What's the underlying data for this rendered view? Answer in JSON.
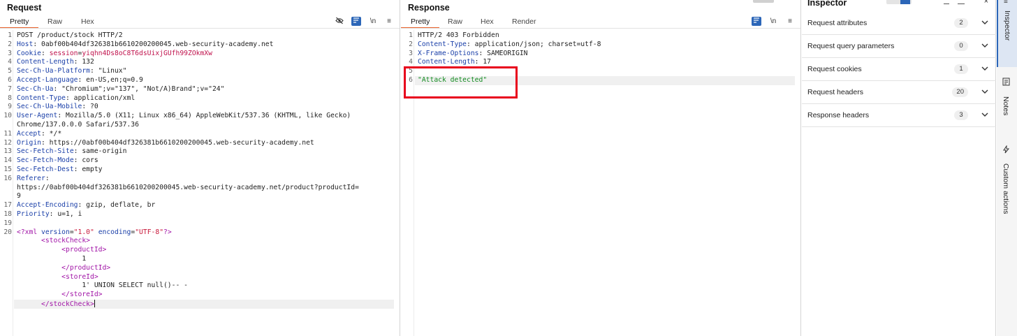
{
  "request": {
    "title": "Request",
    "tabs": [
      "Pretty",
      "Raw",
      "Hex"
    ],
    "active_tab": "Pretty",
    "toolbar": {
      "hide_icon": "eye-slash-icon",
      "wrap_icon": "wrap-lines-icon",
      "newline": "\\n",
      "menu": "≡"
    },
    "line_numbers": [
      "1",
      "2",
      "3",
      "4",
      "5",
      "6",
      "7",
      "8",
      "9",
      "10",
      "",
      "11",
      "12",
      "13",
      "14",
      "15",
      "16",
      "",
      "",
      "17",
      "18",
      "19",
      "20",
      "",
      "",
      "",
      "",
      "",
      "",
      "",
      ""
    ],
    "lines": [
      {
        "n": "1",
        "parts": [
          [
            "POST /product/stock HTTP/2",
            ""
          ]
        ]
      },
      {
        "n": "2",
        "parts": [
          [
            "Host",
            ":k"
          ],
          [
            ": 0abf00b404df326381b6610200200045.web-security-academy.net",
            ""
          ]
        ]
      },
      {
        "n": "3",
        "parts": [
          [
            "Cookie",
            ":k"
          ],
          [
            ": ",
            ""
          ],
          [
            "session",
            "v-red"
          ],
          [
            "=",
            ""
          ],
          [
            "yiqhn4Ds8oC8T6dsUixjGUfh99ZOkmXw",
            "v-red"
          ]
        ]
      },
      {
        "n": "4",
        "parts": [
          [
            "Content-Length",
            ":k"
          ],
          [
            ": 132",
            ""
          ]
        ]
      },
      {
        "n": "5",
        "parts": [
          [
            "Sec-Ch-Ua-Platform",
            ":k"
          ],
          [
            ": \"Linux\"",
            ""
          ]
        ]
      },
      {
        "n": "6",
        "parts": [
          [
            "Accept-Language",
            ":k"
          ],
          [
            ": en-US,en;q=0.9",
            ""
          ]
        ]
      },
      {
        "n": "7",
        "parts": [
          [
            "Sec-Ch-Ua",
            ":k"
          ],
          [
            ": \"Chromium\";v=\"137\", \"Not/A)Brand\";v=\"24\"",
            ""
          ]
        ]
      },
      {
        "n": "8",
        "parts": [
          [
            "Content-Type",
            ":k"
          ],
          [
            ": application/xml",
            ""
          ]
        ]
      },
      {
        "n": "9",
        "parts": [
          [
            "Sec-Ch-Ua-Mobile",
            ":k"
          ],
          [
            ": ?0",
            ""
          ]
        ]
      },
      {
        "n": "10",
        "parts": [
          [
            "User-Agent",
            ":k"
          ],
          [
            ": Mozilla/5.0 (X11; Linux x86_64) AppleWebKit/537.36 (KHTML, like Gecko)",
            ""
          ]
        ]
      },
      {
        "n": "",
        "parts": [
          [
            "Chrome/137.0.0.0 Safari/537.36",
            ""
          ]
        ]
      },
      {
        "n": "11",
        "parts": [
          [
            "Accept",
            ":k"
          ],
          [
            ": */*",
            ""
          ]
        ]
      },
      {
        "n": "12",
        "parts": [
          [
            "Origin",
            ":k"
          ],
          [
            ": https://0abf00b404df326381b6610200200045.web-security-academy.net",
            ""
          ]
        ]
      },
      {
        "n": "13",
        "parts": [
          [
            "Sec-Fetch-Site",
            ":k"
          ],
          [
            ": same-origin",
            ""
          ]
        ]
      },
      {
        "n": "14",
        "parts": [
          [
            "Sec-Fetch-Mode",
            ":k"
          ],
          [
            ": cors",
            ""
          ]
        ]
      },
      {
        "n": "15",
        "parts": [
          [
            "Sec-Fetch-Dest",
            ":k"
          ],
          [
            ": empty",
            ""
          ]
        ]
      },
      {
        "n": "16",
        "parts": [
          [
            "Referer",
            ":k"
          ],
          [
            ":",
            ""
          ]
        ]
      },
      {
        "n": "",
        "parts": [
          [
            "https://0abf00b404df326381b6610200200045.web-security-academy.net/product?productId=",
            ""
          ]
        ]
      },
      {
        "n": "",
        "parts": [
          [
            "9",
            ""
          ]
        ]
      },
      {
        "n": "17",
        "parts": [
          [
            "Accept-Encoding",
            ":k"
          ],
          [
            ": gzip, deflate, br",
            ""
          ]
        ]
      },
      {
        "n": "18",
        "parts": [
          [
            "Priority",
            ":k"
          ],
          [
            ": u=1, i",
            ""
          ]
        ]
      },
      {
        "n": "19",
        "parts": [
          [
            "",
            ""
          ]
        ]
      },
      {
        "n": "20",
        "parts": [
          [
            "<?xml ",
            "t-purple"
          ],
          [
            "version",
            "k"
          ],
          [
            "=",
            ""
          ],
          [
            "\"1.0\"",
            "s-red"
          ],
          [
            " ",
            ""
          ],
          [
            "encoding",
            "k"
          ],
          [
            "=",
            ""
          ],
          [
            "\"UTF-8\"",
            "s-red"
          ],
          [
            "?>",
            "t-purple"
          ]
        ]
      },
      {
        "n": "",
        "parts": [
          [
            "      ",
            ""
          ],
          [
            "<stockCheck>",
            "t-purple"
          ]
        ]
      },
      {
        "n": "",
        "parts": [
          [
            "           ",
            ""
          ],
          [
            "<productId>",
            "t-purple"
          ]
        ]
      },
      {
        "n": "",
        "parts": [
          [
            "                1",
            ""
          ]
        ]
      },
      {
        "n": "",
        "parts": [
          [
            "           ",
            ""
          ],
          [
            "</productId>",
            "t-purple"
          ]
        ]
      },
      {
        "n": "",
        "parts": [
          [
            "           ",
            ""
          ],
          [
            "<storeId>",
            "t-purple"
          ]
        ]
      },
      {
        "n": "",
        "parts": [
          [
            "                1' UNION SELECT null()-- -",
            ""
          ]
        ]
      },
      {
        "n": "",
        "parts": [
          [
            "           ",
            ""
          ],
          [
            "</storeId>",
            "t-purple"
          ]
        ]
      },
      {
        "n": "",
        "parts": [
          [
            "      ",
            ""
          ],
          [
            "</stockCheck>",
            "t-purple"
          ]
        ]
      }
    ]
  },
  "response": {
    "title": "Response",
    "tabs": [
      "Pretty",
      "Raw",
      "Hex",
      "Render"
    ],
    "active_tab": "Pretty",
    "toolbar": {
      "wrap_icon": "wrap-lines-icon",
      "newline": "\\n",
      "menu": "≡"
    },
    "lines": [
      {
        "n": "1",
        "parts": [
          [
            "HTTP/2 403 Forbidden",
            ""
          ]
        ]
      },
      {
        "n": "2",
        "parts": [
          [
            "Content-Type",
            ":k"
          ],
          [
            ": application/json; charset=utf-8",
            ""
          ]
        ]
      },
      {
        "n": "3",
        "parts": [
          [
            "X-Frame-Options",
            ":k"
          ],
          [
            ": SAMEORIGIN",
            ""
          ]
        ]
      },
      {
        "n": "4",
        "parts": [
          [
            "Content-Length",
            ":k"
          ],
          [
            ": 17",
            ""
          ]
        ]
      },
      {
        "n": "5",
        "parts": [
          [
            "",
            ""
          ]
        ]
      },
      {
        "n": "6",
        "parts": [
          [
            "\"Attack detected\"",
            "s-green"
          ]
        ]
      }
    ]
  },
  "inspector": {
    "title": "Inspector",
    "rows": [
      {
        "label": "Request attributes",
        "count": "2"
      },
      {
        "label": "Request query parameters",
        "count": "0"
      },
      {
        "label": "Request cookies",
        "count": "1"
      },
      {
        "label": "Request headers",
        "count": "20"
      },
      {
        "label": "Response headers",
        "count": "3"
      }
    ]
  },
  "side_rail": {
    "tabs": [
      {
        "label": "Inspector",
        "icon": "inspector-icon",
        "active": true
      },
      {
        "label": "Notes",
        "icon": "notes-icon",
        "active": false
      },
      {
        "label": "Custom actions",
        "icon": "custom-actions-icon",
        "active": false
      }
    ]
  },
  "colors": {
    "accent_tab": "#e8622c",
    "annotation": "#e8001c",
    "header_key": "#1a3fa8",
    "xml_tag": "#a012a6",
    "string_green": "#118a1f"
  }
}
